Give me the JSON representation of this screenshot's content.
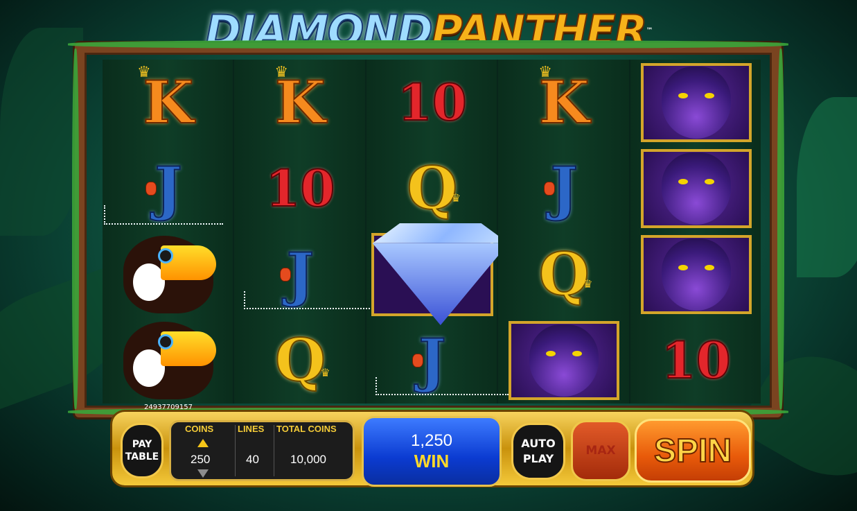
{
  "title": {
    "part1": "DIAMOND",
    "part2": "PANTHER",
    "tm": "™"
  },
  "serial": "24937709157",
  "reels": [
    [
      "K",
      "J",
      "toucan",
      "toucan"
    ],
    [
      "K",
      "10",
      "J",
      "Q"
    ],
    [
      "10",
      "Q",
      "diamond",
      "J"
    ],
    [
      "K",
      "J",
      "Q",
      "panther"
    ],
    [
      "panther",
      "panther",
      "panther",
      "10"
    ]
  ],
  "icons": {
    "toucan": "toucan-symbol-icon",
    "panther": "panther-symbol-icon",
    "diamond": "diamond-symbol-icon"
  },
  "controls": {
    "pay_table": "PAY TABLE",
    "coins_label": "COINS",
    "coins_value": "250",
    "lines_label": "LINES",
    "lines_value": "40",
    "total_label": "TOTAL COINS",
    "total_value": "10,000",
    "win_amount": "1,250",
    "win_label": "WIN",
    "auto_play": "AUTO PLAY",
    "max": "MAX",
    "spin": "SPIN"
  },
  "colors": {
    "jungle_green": "#1f8f6e",
    "frame_wood": "#7a4420",
    "gold": "#f2c84a",
    "win_blue": "#0b3bd1",
    "spin_orange": "#e85a0a"
  }
}
